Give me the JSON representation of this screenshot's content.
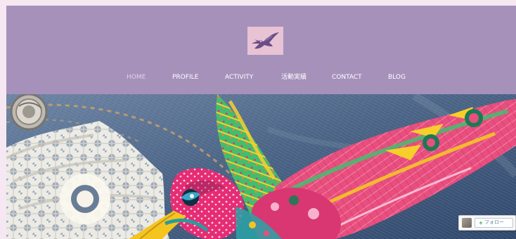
{
  "header": {
    "logo_icon": "hummingbird-icon",
    "nav": [
      {
        "label": "HOME",
        "state": "active"
      },
      {
        "label": "PROFILE",
        "state": "default"
      },
      {
        "label": "ACTIVITY",
        "state": "default"
      },
      {
        "label": "活動実績",
        "state": "default"
      },
      {
        "label": "CONTACT",
        "state": "default"
      },
      {
        "label": "BLOG",
        "state": "default"
      }
    ]
  },
  "hero": {
    "image_icon": "hummingbird-photo-icon"
  },
  "follow_widget": {
    "avatar_icon": "avatar-icon",
    "plus_icon": "+",
    "label": "フォロー"
  },
  "colors": {
    "header": "#a691bb",
    "logo_background": "#e8c3d4",
    "nav_text": "#ffffff",
    "denim": "#536c8d",
    "bird_pink": "#e84e7c",
    "bird_green": "#42b96f",
    "bird_yellow": "#f4c526"
  }
}
